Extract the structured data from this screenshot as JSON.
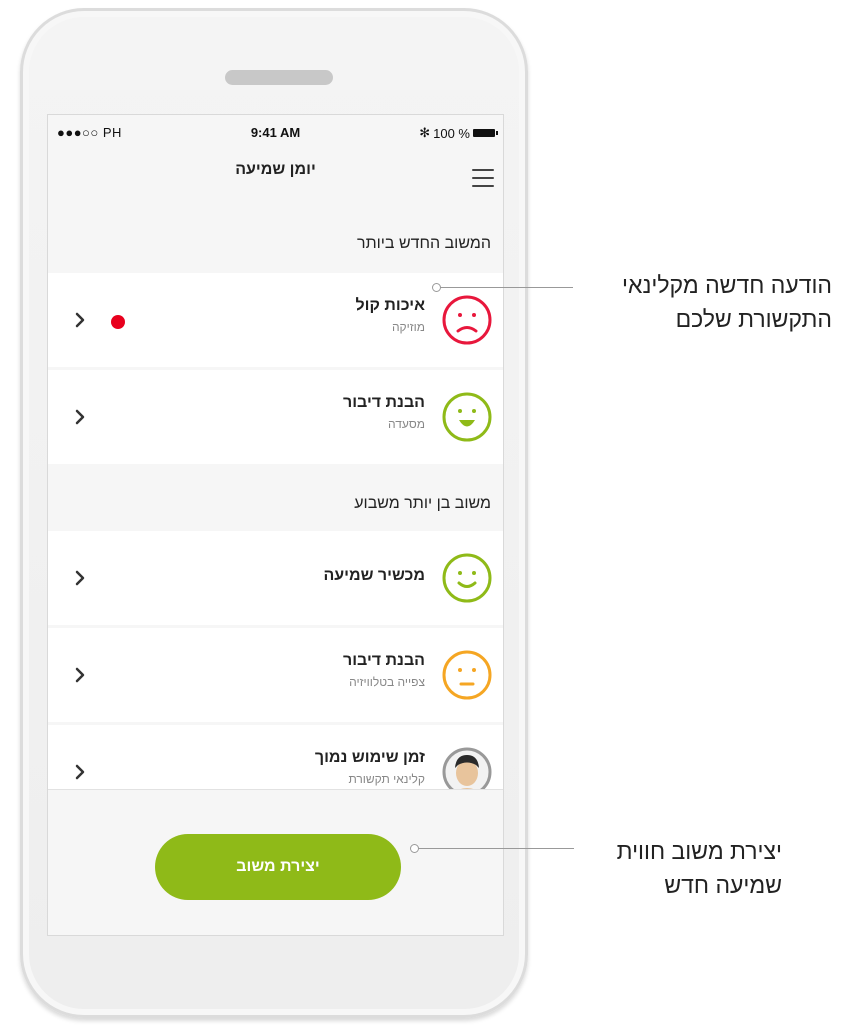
{
  "status_bar": {
    "carrier": "●●●○○ PH",
    "time": "9:41 AM",
    "bluetooth": "✻",
    "battery_text": "100 %"
  },
  "header": {
    "title": "יומן שמיעה"
  },
  "sections": [
    {
      "title": "המשוב החדש ביותר",
      "items": [
        {
          "label": "איכות קול",
          "sub": "מוזיקה",
          "face": "sad-face-icon",
          "color": "#e8173c",
          "new_message": true
        },
        {
          "label": "הבנת דיבור",
          "sub": "מסעדה",
          "face": "laughing-face-icon",
          "color": "#8fba18",
          "new_message": false
        }
      ]
    },
    {
      "title": "משוב בן יותר משבוע",
      "items": [
        {
          "label": "מכשיר שמיעה",
          "sub": "",
          "face": "smiling-face-icon",
          "color": "#8fba18",
          "new_message": false
        },
        {
          "label": "הבנת דיבור",
          "sub": "צפייה בטלוויזיה",
          "face": "neutral-face-icon",
          "color": "#f5a623",
          "new_message": false
        },
        {
          "label": "זמן שימוש נמוך",
          "sub": "קלינאי תקשורת",
          "face": "clinician-avatar",
          "color": "#999999",
          "new_message": false
        }
      ]
    }
  ],
  "create_button": {
    "label": "יצירת משוב"
  },
  "annotations": {
    "new_message_line1": "הודעה חדשה מקלינאי",
    "new_message_line2": "התקשורת שלכם",
    "create_line1": "יצירת משוב חווית",
    "create_line2": "שמיעה חדש"
  },
  "colors": {
    "accent_green": "#8fba18",
    "alert_red": "#e8001d"
  }
}
